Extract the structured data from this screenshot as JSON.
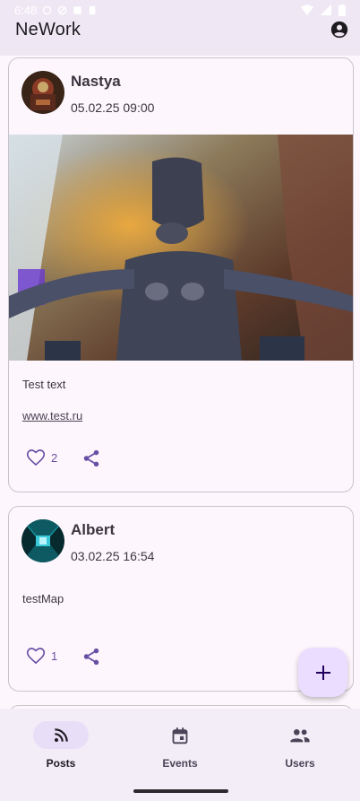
{
  "status_bar": {
    "time": "6:48"
  },
  "app_bar": {
    "title": "NeWork",
    "account_icon": "account-circle-icon"
  },
  "posts": [
    {
      "author": "Nastya",
      "published": "05.02.25 09:00",
      "content": "Test text",
      "link": "www.test.ru",
      "likes": "2",
      "has_image": true
    },
    {
      "author": "Albert",
      "published": "03.02.25 16:54",
      "content": "testMap",
      "likes": "1",
      "has_image": false
    }
  ],
  "fab": {
    "icon": "add-icon"
  },
  "bottom_nav": {
    "items": [
      {
        "label": "Posts",
        "icon": "rss-feed-icon",
        "active": true
      },
      {
        "label": "Events",
        "icon": "calendar-icon",
        "active": false
      },
      {
        "label": "Users",
        "icon": "people-icon",
        "active": false
      }
    ]
  },
  "colors": {
    "accent": "#6750a4",
    "nav_indicator": "#e8def8",
    "fab_background": "#eaddff",
    "surface": "#fdf7fd"
  }
}
